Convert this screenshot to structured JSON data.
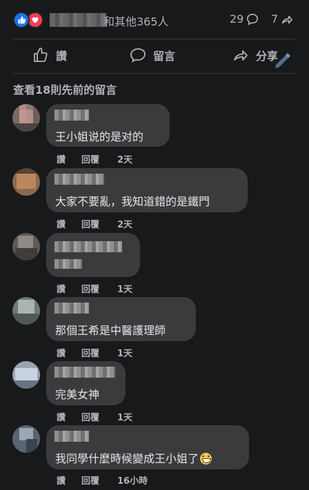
{
  "reactions": {
    "summary_suffix": "和其他365人",
    "comments_count": "29",
    "shares_count": "7"
  },
  "actions": {
    "like": "讚",
    "comment": "留言",
    "share": "分享"
  },
  "view_previous": "查看18則先前的留言",
  "comments": [
    {
      "text": "王小姐说的是对的",
      "like": "讚",
      "reply": "回覆",
      "time": "2天"
    },
    {
      "text": "大家不要亂，我知道錯的是鐵門",
      "like": "讚",
      "reply": "回覆",
      "time": "2天"
    },
    {
      "text": "",
      "like": "讚",
      "reply": "回覆",
      "time": "1天"
    },
    {
      "text": "那個王希是中醫護理師",
      "like": "讚",
      "reply": "回覆",
      "time": "1天"
    },
    {
      "text": "完美女神",
      "like": "讚",
      "reply": "回覆",
      "time": "1天"
    },
    {
      "text": "我同學什麼時候變成王小姐了",
      "like": "讚",
      "reply": "回覆",
      "time": "16小時"
    }
  ],
  "colors": {
    "background": "#18191a",
    "bubble": "#3a3b3c",
    "like_blue": "#1877f2",
    "heart_red": "#f33e58",
    "secondary_text": "#b0b3b8"
  }
}
